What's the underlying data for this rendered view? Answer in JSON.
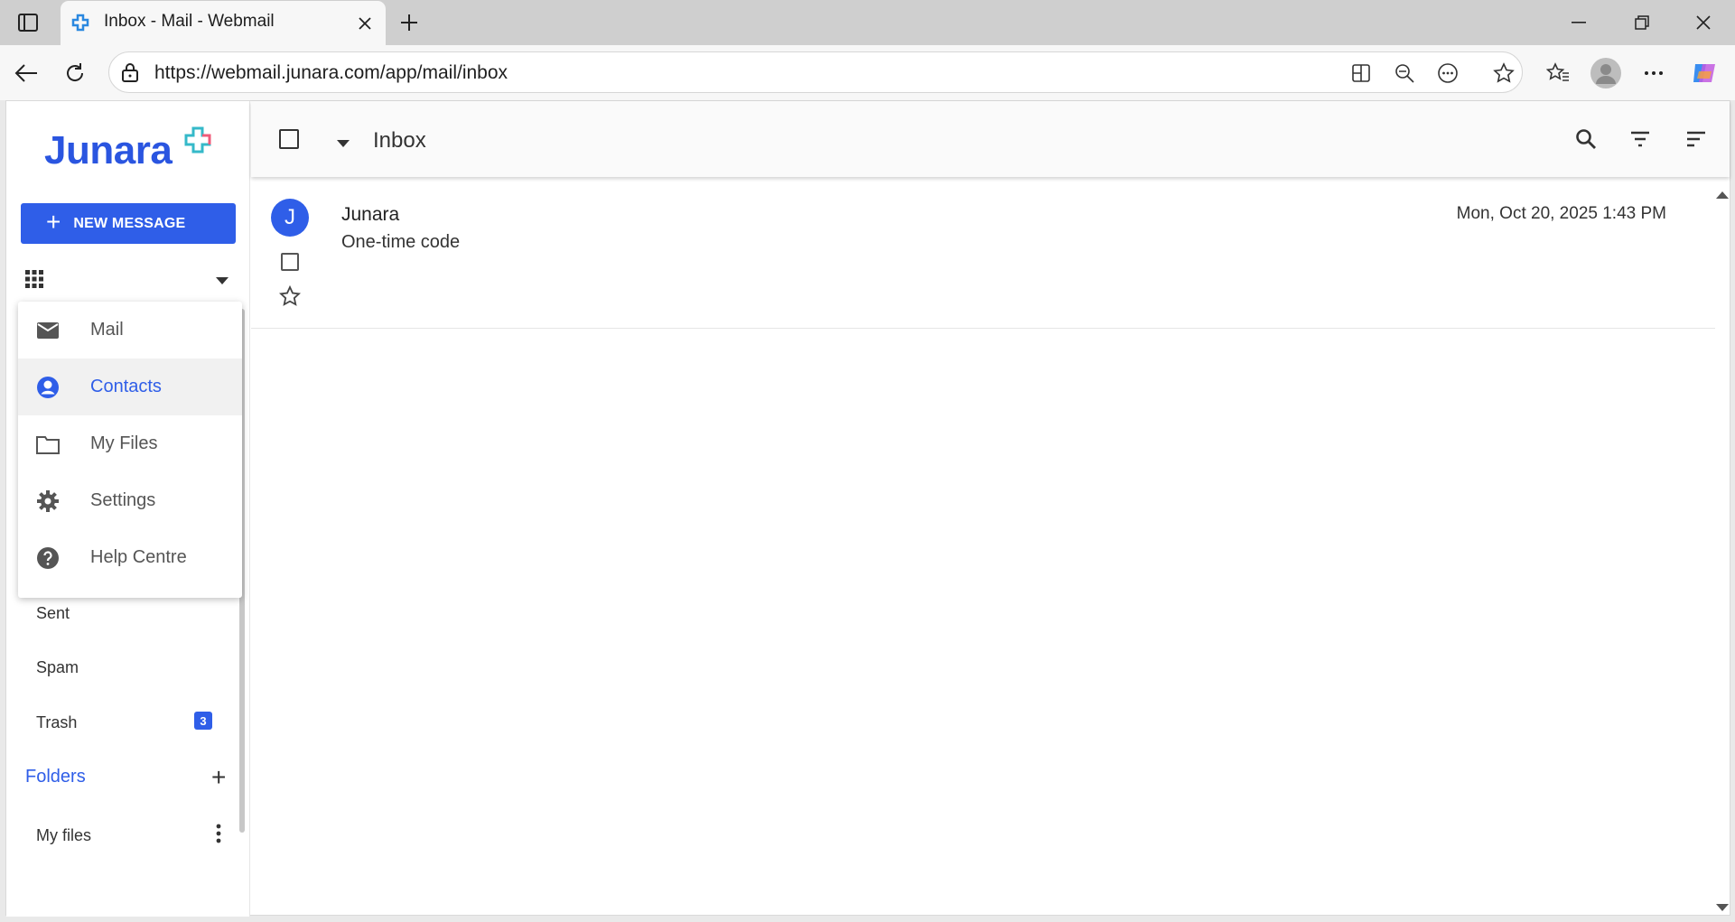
{
  "browser": {
    "tab_title": "Inbox - Mail - Webmail",
    "url": "https://webmail.junara.com/app/mail/inbox"
  },
  "sidebar": {
    "logo_text": "Junara",
    "new_message_label": "NEW MESSAGE",
    "app_menu": [
      {
        "label": "Mail",
        "icon": "mail-icon"
      },
      {
        "label": "Contacts",
        "icon": "contacts-icon",
        "active": true
      },
      {
        "label": "My Files",
        "icon": "folder-icon"
      },
      {
        "label": "Settings",
        "icon": "gear-icon"
      },
      {
        "label": "Help Centre",
        "icon": "help-icon"
      }
    ],
    "nav": {
      "sent": "Sent",
      "spam": "Spam",
      "trash": "Trash",
      "trash_count": "3"
    },
    "folders_heading": "Folders",
    "folders": [
      {
        "label": "My files"
      }
    ]
  },
  "main": {
    "title": "Inbox",
    "messages": [
      {
        "avatar": "J",
        "sender": "Junara",
        "subject": "One-time code",
        "date": "Mon, Oct 20, 2025 1:43 PM"
      }
    ]
  },
  "colors": {
    "accent": "#2f5ee8"
  }
}
